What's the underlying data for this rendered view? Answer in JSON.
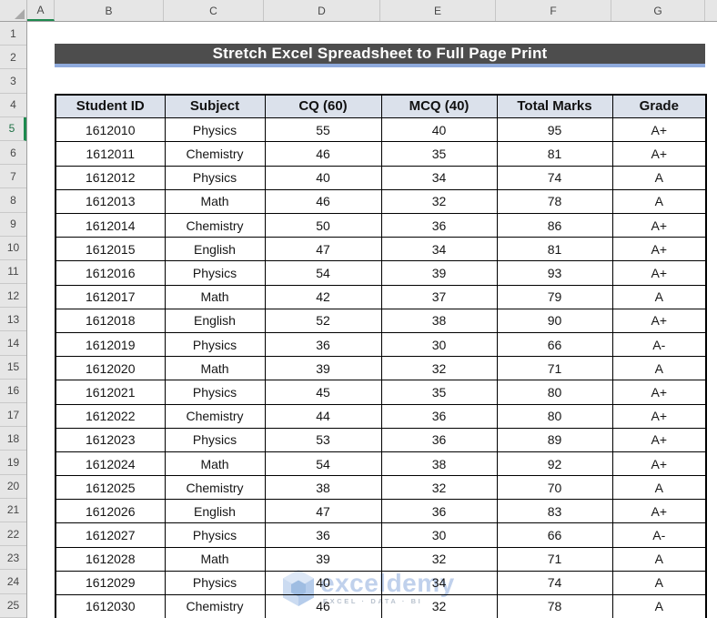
{
  "sheet": {
    "column_letters": [
      "A",
      "B",
      "C",
      "D",
      "E",
      "F",
      "G"
    ],
    "row_numbers": [
      1,
      2,
      3,
      4,
      5,
      6,
      7,
      8,
      9,
      10,
      11,
      12,
      13,
      14,
      15,
      16,
      17,
      18,
      19,
      20,
      21,
      22,
      23,
      24,
      25
    ],
    "selected_row": 5,
    "selected_column": "A",
    "selection_accent_color": "#1E8A4F"
  },
  "banner": {
    "title": "Stretch Excel Spreadsheet to Full Page Print",
    "bg_color": "#4D4D4D",
    "underline_color": "#8FAADC"
  },
  "table": {
    "headers": [
      "Student ID",
      "Subject",
      "CQ (60)",
      "MCQ (40)",
      "Total Marks",
      "Grade"
    ],
    "header_bg": "#DBE1EB",
    "border_color": "#000000",
    "rows": [
      [
        "1612010",
        "Physics",
        "55",
        "40",
        "95",
        "A+"
      ],
      [
        "1612011",
        "Chemistry",
        "46",
        "35",
        "81",
        "A+"
      ],
      [
        "1612012",
        "Physics",
        "40",
        "34",
        "74",
        "A"
      ],
      [
        "1612013",
        "Math",
        "46",
        "32",
        "78",
        "A"
      ],
      [
        "1612014",
        "Chemistry",
        "50",
        "36",
        "86",
        "A+"
      ],
      [
        "1612015",
        "English",
        "47",
        "34",
        "81",
        "A+"
      ],
      [
        "1612016",
        "Physics",
        "54",
        "39",
        "93",
        "A+"
      ],
      [
        "1612017",
        "Math",
        "42",
        "37",
        "79",
        "A"
      ],
      [
        "1612018",
        "English",
        "52",
        "38",
        "90",
        "A+"
      ],
      [
        "1612019",
        "Physics",
        "36",
        "30",
        "66",
        "A-"
      ],
      [
        "1612020",
        "Math",
        "39",
        "32",
        "71",
        "A"
      ],
      [
        "1612021",
        "Physics",
        "45",
        "35",
        "80",
        "A+"
      ],
      [
        "1612022",
        "Chemistry",
        "44",
        "36",
        "80",
        "A+"
      ],
      [
        "1612023",
        "Physics",
        "53",
        "36",
        "89",
        "A+"
      ],
      [
        "1612024",
        "Math",
        "54",
        "38",
        "92",
        "A+"
      ],
      [
        "1612025",
        "Chemistry",
        "38",
        "32",
        "70",
        "A"
      ],
      [
        "1612026",
        "English",
        "47",
        "36",
        "83",
        "A+"
      ],
      [
        "1612027",
        "Physics",
        "36",
        "30",
        "66",
        "A-"
      ],
      [
        "1612028",
        "Math",
        "39",
        "32",
        "71",
        "A"
      ],
      [
        "1612029",
        "Physics",
        "40",
        "34",
        "74",
        "A"
      ],
      [
        "1612030",
        "Chemistry",
        "46",
        "32",
        "78",
        "A"
      ]
    ]
  },
  "watermark": {
    "text": "exceldemy",
    "subtext": "EXCEL · DATA · BI",
    "logo": "exceldemy-hexagon-logo",
    "color": "#B6C9E9"
  }
}
